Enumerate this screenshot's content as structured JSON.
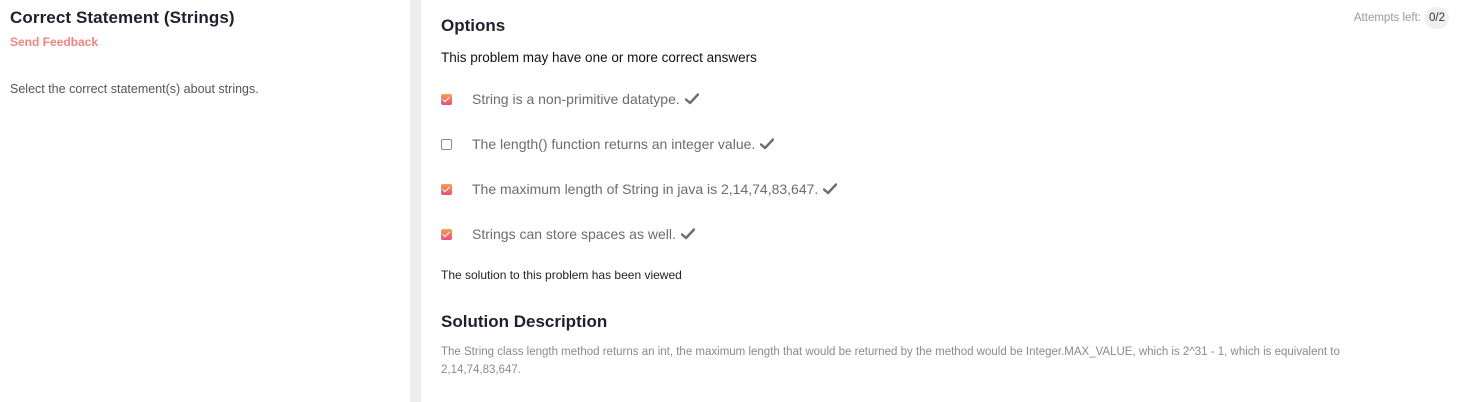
{
  "problem": {
    "title": "Correct Statement (Strings)",
    "feedback_link": "Send Feedback",
    "statement": "Select the correct statement(s) about strings."
  },
  "options_panel": {
    "heading": "Options",
    "attempts_label": "Attempts left:",
    "attempts_value": "0/2",
    "subtitle": "This problem may have one or more correct answers",
    "options": [
      {
        "text": "String is a non-primitive datatype.",
        "checked": true,
        "correct": true
      },
      {
        "text": "The length() function returns an integer value.",
        "checked": false,
        "correct": true
      },
      {
        "text": "The maximum length of String in java is 2,14,74,83,647.",
        "checked": true,
        "correct": true
      },
      {
        "text": "Strings can store spaces as well.",
        "checked": true,
        "correct": true
      }
    ],
    "viewed_note": "The solution to this problem has been viewed"
  },
  "solution": {
    "heading": "Solution Description",
    "text": "The String class length method returns an int, the maximum length that would be returned by the method would be Integer.MAX_VALUE, which is 2^31 - 1, which is equivalent to 2,14,74,83,647."
  },
  "colors": {
    "accent": "#f0857e",
    "checkbox_gradient_top": "#f7a14b",
    "checkbox_gradient_bottom": "#ef4a7a",
    "tick": "#6c6c6c"
  }
}
